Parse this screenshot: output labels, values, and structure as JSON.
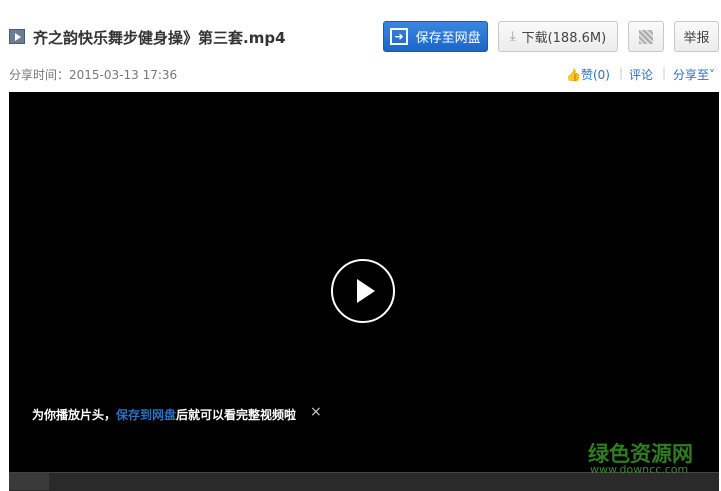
{
  "title": "齐之韵快乐舞步健身操》第三套.mp4",
  "meta": {
    "label": "分享时间：",
    "time": "2015-03-13 17:36"
  },
  "buttons": {
    "save": "保存至网盘",
    "download": "下载(188.6M)",
    "report": "举报"
  },
  "actions": {
    "like": "赞(0)",
    "comment": "评论",
    "share": "分享至"
  },
  "notice": {
    "prefix": "为你播放片头，",
    "link": "保存到网盘",
    "suffix": "后就可以看完整视频啦",
    "close": "×"
  },
  "watermark": {
    "name": "绿色资源网",
    "url": "www.downcc.com"
  }
}
